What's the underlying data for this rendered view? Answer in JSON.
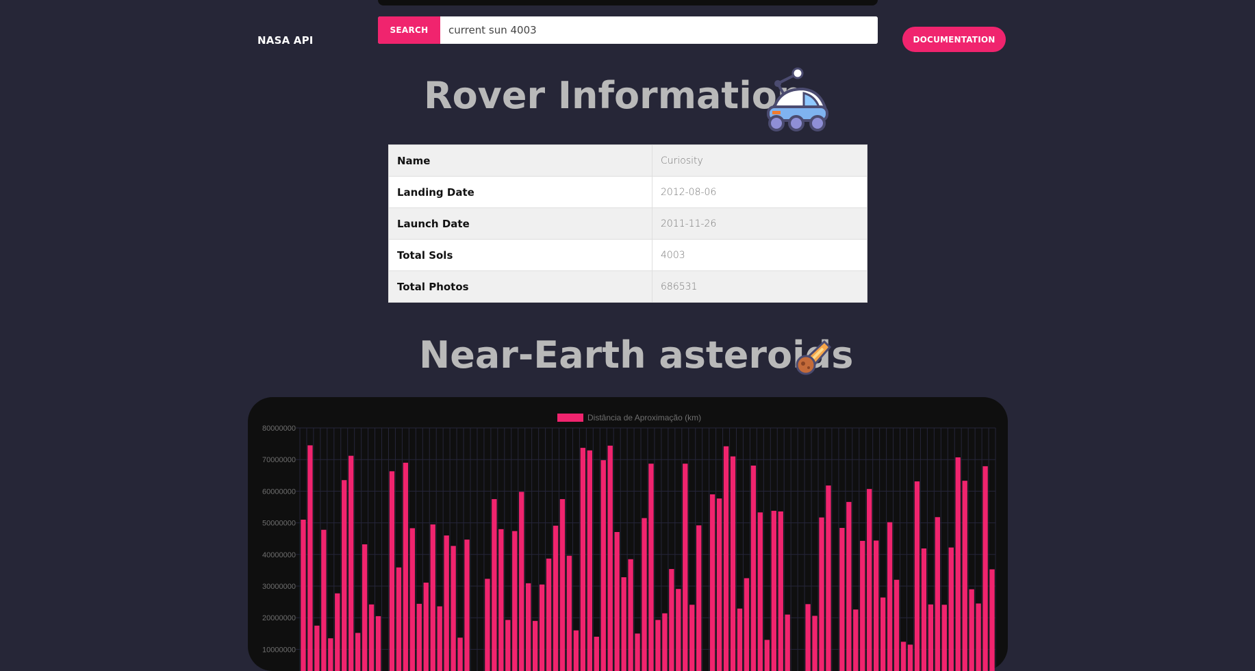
{
  "header": {
    "brand": "NASA API",
    "search_button": "SEARCH",
    "search_value": "current sun 4003",
    "documentation_button": "DOCUMENTATION",
    "social_icons": [
      "twitter-icon",
      "facebook-icon",
      "instagram-icon",
      "github-icon"
    ]
  },
  "rover": {
    "title": "Rover Information",
    "rows": [
      {
        "label": "Name",
        "value": "Curiosity"
      },
      {
        "label": "Landing Date",
        "value": "2012-08-06"
      },
      {
        "label": "Launch Date",
        "value": "2011-11-26"
      },
      {
        "label": "Total Sols",
        "value": "4003"
      },
      {
        "label": "Total Photos",
        "value": "686531"
      }
    ]
  },
  "asteroids": {
    "title": "Near-Earth asteroids"
  },
  "colors": {
    "accent": "#f0246e",
    "background": "#262637",
    "chart_bg": "#0f0f0f",
    "title_text": "#b9b9b9"
  },
  "chart_data": {
    "type": "bar",
    "legend": "Distância de Aproximação (km)",
    "legend_position": "top",
    "ylim": [
      0,
      80000000
    ],
    "yticks": [
      "80000000",
      "70000000",
      "60000000",
      "50000000",
      "40000000",
      "30000000",
      "20000000",
      "10000000"
    ],
    "grid": true,
    "values": [
      51000000,
      74500000,
      17500000,
      47800000,
      13500000,
      27700000,
      63500000,
      71200000,
      15200000,
      43200000,
      24200000,
      20500000,
      0,
      66300000,
      35900000,
      69000000,
      48300000,
      24400000,
      31100000,
      49500000,
      23600000,
      46000000,
      42700000,
      13700000,
      44700000,
      0,
      0,
      32300000,
      57500000,
      48000000,
      19300000,
      47400000,
      59800000,
      30900000,
      19000000,
      30500000,
      38700000,
      49100000,
      57500000,
      39600000,
      16000000,
      73700000,
      72900000,
      14000000,
      69800000,
      74400000,
      47100000,
      32800000,
      38500000,
      15000000,
      51500000,
      68700000,
      19300000,
      21400000,
      35400000,
      29100000,
      68700000,
      24100000,
      49200000,
      0,
      59000000,
      57700000,
      74200000,
      71000000,
      22900000,
      32500000,
      68100000,
      53300000,
      13000000,
      53800000,
      53600000,
      21000000,
      0,
      0,
      24300000,
      20600000,
      51700000,
      61800000,
      0,
      48400000,
      56600000,
      22600000,
      44300000,
      60700000,
      44400000,
      26400000,
      50200000,
      32000000,
      12400000,
      11500000,
      63100000,
      41900000,
      24200000,
      51800000,
      24100000,
      42200000,
      70700000,
      63300000,
      29000000,
      24500000,
      67900000,
      35300000
    ]
  }
}
